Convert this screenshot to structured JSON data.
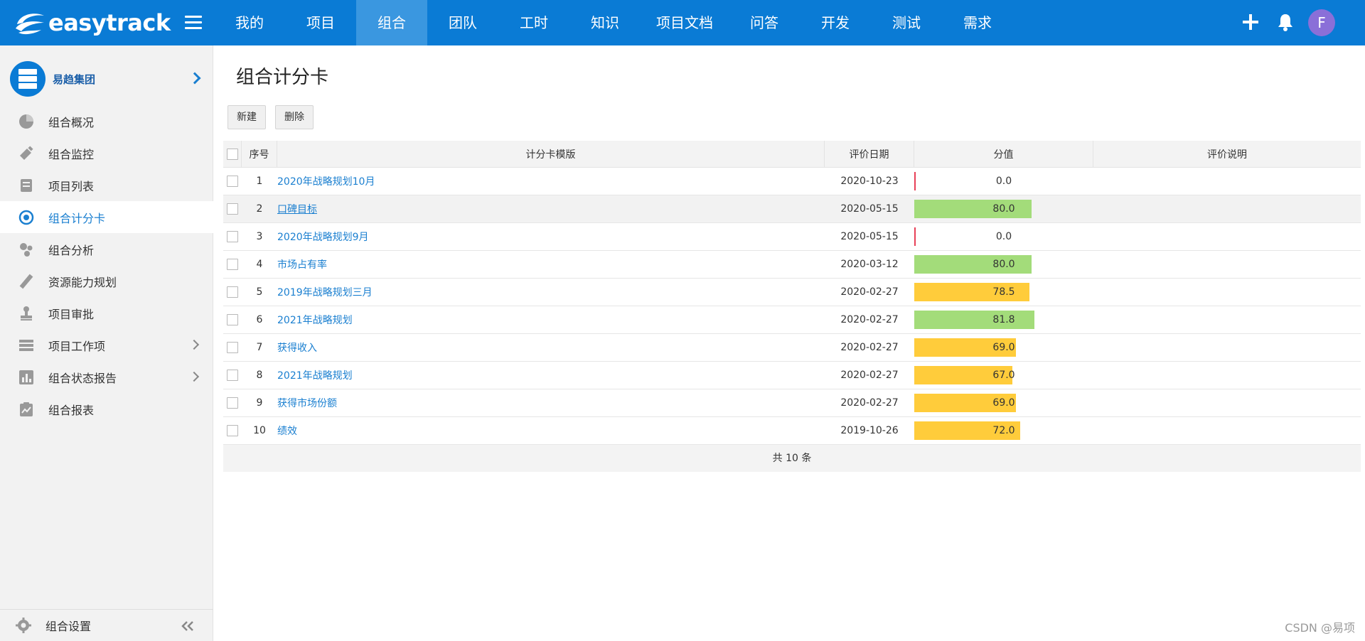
{
  "app": {
    "logo_text": "easytrack"
  },
  "nav": {
    "items": [
      {
        "label": "我的"
      },
      {
        "label": "项目"
      },
      {
        "label": "组合"
      },
      {
        "label": "团队"
      },
      {
        "label": "工时"
      },
      {
        "label": "知识"
      },
      {
        "label": "项目文档"
      },
      {
        "label": "问答"
      },
      {
        "label": "开发"
      },
      {
        "label": "测试"
      },
      {
        "label": "需求"
      }
    ],
    "active": "组合",
    "avatar_letter": "F"
  },
  "sidebar": {
    "org_name": "易趋集团",
    "items": [
      {
        "label": "组合概况",
        "icon": "pie-chart-icon"
      },
      {
        "label": "组合监控",
        "icon": "monitor-icon"
      },
      {
        "label": "项目列表",
        "icon": "inbox-list-icon"
      },
      {
        "label": "组合计分卡",
        "icon": "target-icon",
        "active": true
      },
      {
        "label": "组合分析",
        "icon": "bubbles-icon"
      },
      {
        "label": "资源能力规划",
        "icon": "ruler-icon"
      },
      {
        "label": "项目审批",
        "icon": "stamp-icon"
      },
      {
        "label": "项目工作项",
        "icon": "list-icon",
        "has_children": true
      },
      {
        "label": "组合状态报告",
        "icon": "bar-report-icon",
        "has_children": true
      },
      {
        "label": "组合报表",
        "icon": "clipboard-chart-icon"
      }
    ],
    "footer_label": "组合设置"
  },
  "main": {
    "title": "组合计分卡",
    "new_button": "新建",
    "delete_button": "删除",
    "columns": {
      "index": "序号",
      "template": "计分卡模版",
      "date": "评价日期",
      "score": "分值",
      "note": "评价说明"
    },
    "rows": [
      {
        "index": "1",
        "name": "2020年战略规划10月",
        "date": "2020-10-23",
        "score": "0.0"
      },
      {
        "index": "2",
        "name": "口碑目标",
        "date": "2020-05-15",
        "score": "80.0"
      },
      {
        "index": "3",
        "name": "2020年战略规划9月",
        "date": "2020-05-15",
        "score": "0.0"
      },
      {
        "index": "4",
        "name": "市场占有率",
        "date": "2020-03-12",
        "score": "80.0"
      },
      {
        "index": "5",
        "name": "2019年战略规划三月",
        "date": "2020-02-27",
        "score": "78.5"
      },
      {
        "index": "6",
        "name": "2021年战略规划",
        "date": "2020-02-27",
        "score": "81.8"
      },
      {
        "index": "7",
        "name": "获得收入",
        "date": "2020-02-27",
        "score": "69.0"
      },
      {
        "index": "8",
        "name": "2021年战略规划",
        "date": "2020-02-27",
        "score": "67.0"
      },
      {
        "index": "9",
        "name": "获得市场份额",
        "date": "2020-02-27",
        "score": "69.0"
      },
      {
        "index": "10",
        "name": "绩效",
        "date": "2019-10-26",
        "score": "72.0"
      }
    ],
    "total_text": "共 10 条"
  },
  "colors": {
    "brand": "#0a7bd5",
    "score_high": "#a3dc7a",
    "score_mid": "#ffcc3b",
    "score_zero": "#e84057"
  },
  "watermark": "CSDN @易项"
}
